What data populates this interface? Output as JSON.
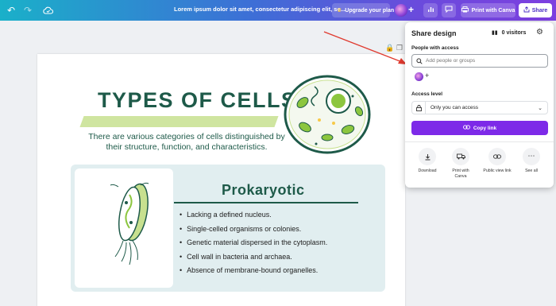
{
  "topbar": {
    "title": "Lorem ipsum dolor sit amet, consectetur adipiscing elit, se...",
    "upgrade_label": "Upgrade your plan",
    "print_label": "Print with Canva",
    "share_label": "Share",
    "icons": [
      "undo-icon",
      "redo-icon",
      "cloud-sync-icon",
      "crown-icon",
      "chart-icon",
      "comment-icon",
      "printer-icon",
      "share-icon"
    ]
  },
  "canvas": {
    "heading": "TYPES OF CELLS",
    "intro": "There are various categories of cells distinguished by their structure, function, and characteristics.",
    "card_title": "Prokaryotic",
    "bullets": [
      "Lacking a defined nucleus.",
      "Single-celled organisms or colonies.",
      "Genetic material dispersed in the cytoplasm.",
      "Cell wall in bacteria and archaea.",
      "Absence of membrane-bound organelles."
    ]
  },
  "share_panel": {
    "title": "Share design",
    "visitors": "0 visitors",
    "people_label": "People with access",
    "search_placeholder": "Add people or groups",
    "access_label": "Access level",
    "access_value": "Only you can access",
    "copy_label": "Copy link",
    "options": [
      {
        "label": "Download",
        "icon": "download-icon"
      },
      {
        "label": "Print with Canva",
        "icon": "truck-icon"
      },
      {
        "label": "Public view link",
        "icon": "link-icon"
      },
      {
        "label": "See all",
        "icon": "more-icon"
      }
    ]
  },
  "colors": {
    "accent": "#7d2ae8",
    "heading_green": "#1e5a49",
    "highlight_green": "#c7e08f",
    "card_bg": "#e1eef0"
  }
}
